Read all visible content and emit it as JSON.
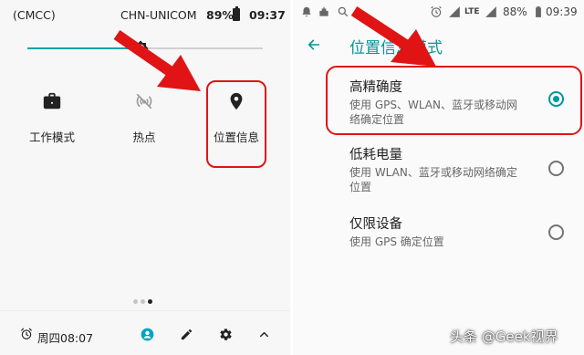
{
  "left": {
    "status": {
      "carrier": "(CMCC)",
      "carrier2": "CHN-UNICOM",
      "battery": "89%",
      "time": "09:37"
    },
    "brightness_level": 0.48,
    "tiles": [
      {
        "label": "工作模式",
        "icon": "briefcase-icon"
      },
      {
        "label": "热点",
        "icon": "hotspot-off-icon"
      },
      {
        "label": "位置信息",
        "icon": "location-pin-icon"
      }
    ],
    "page_dots": {
      "count": 3,
      "active": 2
    },
    "footer": {
      "alarm_time": "周四08:07"
    }
  },
  "right": {
    "status": {
      "network": "LTE",
      "battery": "88%",
      "time": "09:39"
    },
    "title": "位置信息模式",
    "options": [
      {
        "name": "高精确度",
        "desc": "使用 GPS、WLAN、蓝牙或移动网络确定位置",
        "selected": true
      },
      {
        "name": "低耗电量",
        "desc": "使用 WLAN、蓝牙或移动网络确定位置",
        "selected": false
      },
      {
        "name": "仅限设备",
        "desc": "使用 GPS 确定位置",
        "selected": false
      }
    ]
  },
  "watermark": "头条 @Geek视界",
  "colors": {
    "accent": "#00979a",
    "highlight": "#e01414",
    "arrow": "#e01414"
  }
}
